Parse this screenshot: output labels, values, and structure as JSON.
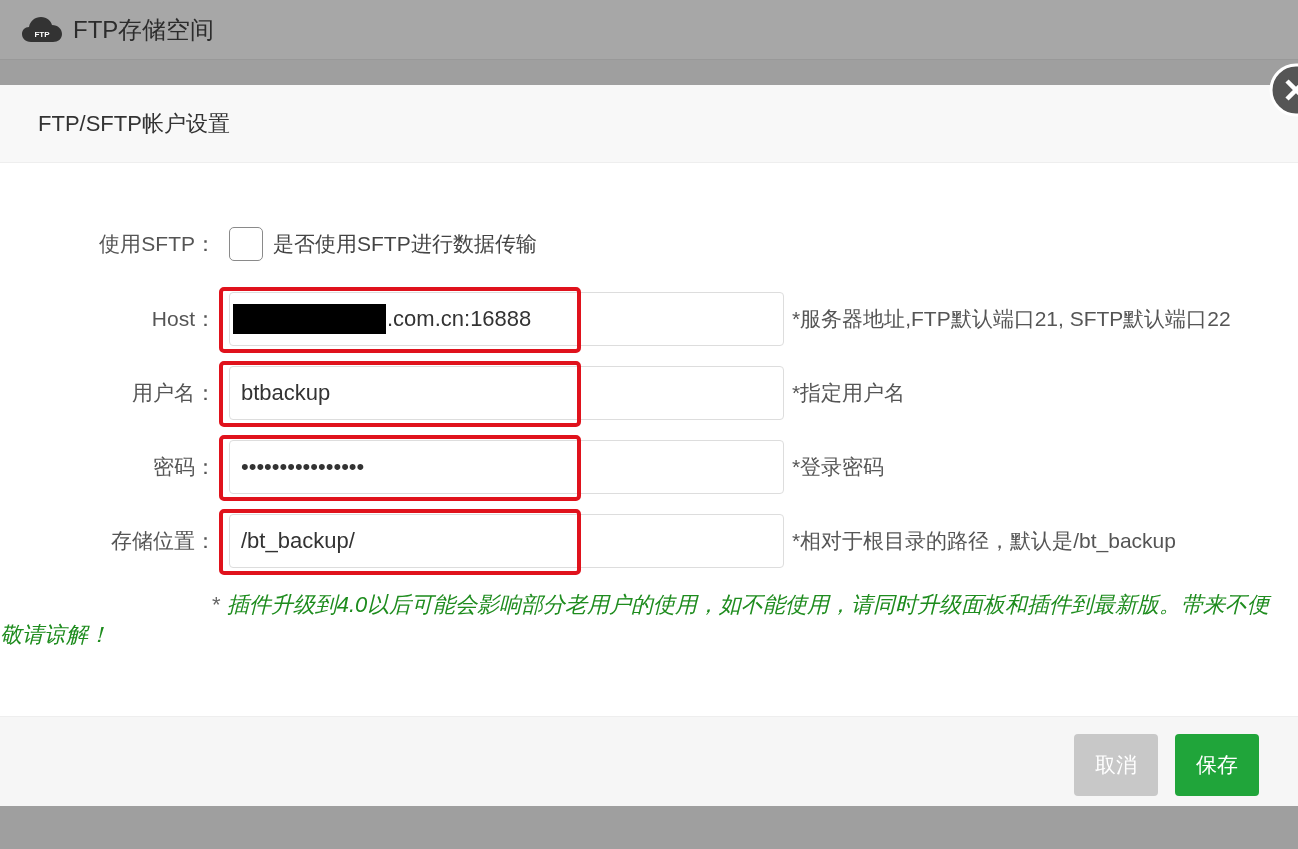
{
  "page_header": {
    "icon_label": "FTP",
    "title": "FTP存储空间"
  },
  "dialog": {
    "title": "FTP/SFTP帐户设置",
    "sftp": {
      "label": "使用SFTP：",
      "checked": false,
      "text": "是否使用SFTP进行数据传输"
    },
    "fields": [
      {
        "label": "Host：",
        "value": ".com.cn:16888",
        "redacted": true,
        "highlighted": true,
        "hint": "*服务器地址,FTP默认端口21, SFTP默认端口22"
      },
      {
        "label": "用户名：",
        "value": "btbackup",
        "redacted": false,
        "highlighted": true,
        "hint": "*指定用户名"
      },
      {
        "label": "密码：",
        "value": "••••••••••••••••",
        "redacted": false,
        "highlighted": true,
        "hint": "*登录密码"
      },
      {
        "label": "存储位置：",
        "value": "/bt_backup/",
        "redacted": false,
        "highlighted": true,
        "hint": "*相对于根目录的路径，默认是/bt_backup"
      }
    ],
    "notice": {
      "marker": "*",
      "text": "插件升级到4.0以后可能会影响部分老用户的使用，如不能使用，请同时升级面板和插件到最新版。带来不便敬请谅解！"
    },
    "buttons": [
      {
        "label": "取消",
        "kind": "cancel"
      },
      {
        "label": "保存",
        "kind": "primary"
      }
    ]
  }
}
